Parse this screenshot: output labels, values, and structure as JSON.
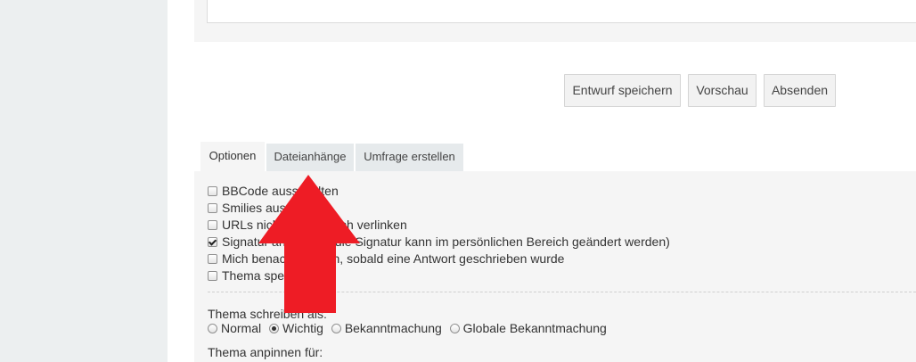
{
  "buttons": {
    "draft": "Entwurf speichern",
    "preview": "Vorschau",
    "submit": "Absenden"
  },
  "tabs": [
    {
      "label": "Optionen",
      "active": true
    },
    {
      "label": "Dateianhänge",
      "active": false
    },
    {
      "label": "Umfrage erstellen",
      "active": false
    }
  ],
  "options": [
    {
      "label": "BBCode ausschalten",
      "checked": false
    },
    {
      "label": "Smilies ausschalten",
      "checked": false
    },
    {
      "label": "URLs nicht automatisch verlinken",
      "checked": false
    },
    {
      "label": "Signatur anhängen (die Signatur kann im persönlichen Bereich geändert werden)",
      "checked": true
    },
    {
      "label": "Mich benachrichtigen, sobald eine Antwort geschrieben wurde",
      "checked": false
    },
    {
      "label": "Thema sperren",
      "checked": false
    }
  ],
  "topic_type": {
    "label": "Thema schreiben als:",
    "options": [
      {
        "label": "Normal",
        "selected": false
      },
      {
        "label": "Wichtig",
        "selected": true
      },
      {
        "label": "Bekanntmachung",
        "selected": false
      },
      {
        "label": "Globale Bekanntmachung",
        "selected": false
      }
    ]
  },
  "pin_label": "Thema anpinnen für:",
  "colors": {
    "arrow": "#ee1c25",
    "panel_bg": "#f5f5f5",
    "tab_bg": "#e6eaec"
  },
  "annotation_icon": "red-arrow-up-icon"
}
